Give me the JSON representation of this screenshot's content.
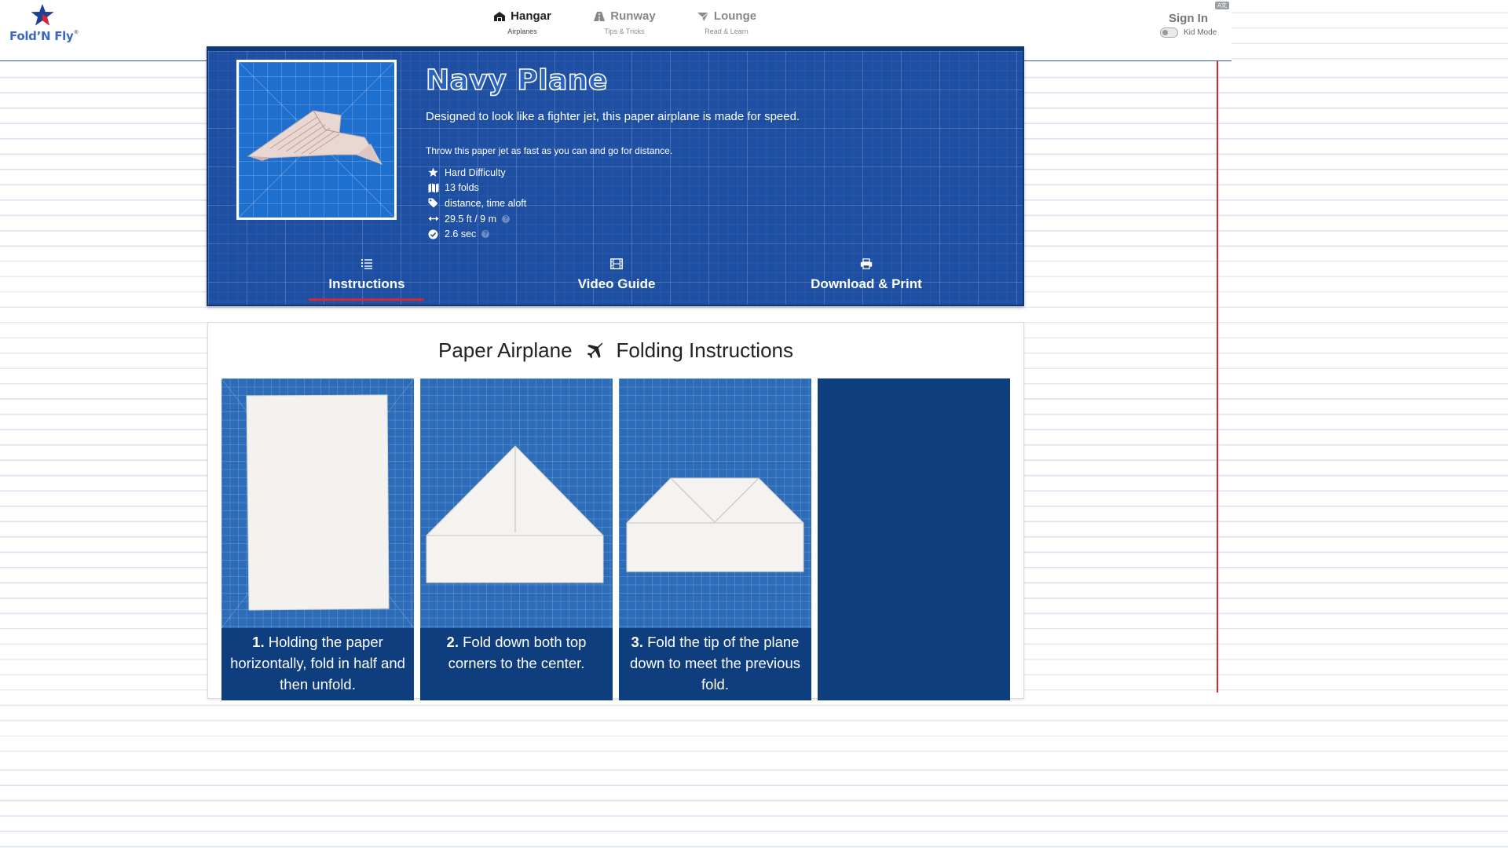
{
  "logo": {
    "brand": "Fold’N Fly",
    "registered": "®"
  },
  "nav": [
    {
      "label": "Hangar",
      "sub": "Airplanes",
      "icon": "hangar-icon",
      "active": true
    },
    {
      "label": "Runway",
      "sub": "Tips & Tricks",
      "icon": "runway-icon",
      "active": false
    },
    {
      "label": "Lounge",
      "sub": "Read & Learn",
      "icon": "lounge-icon",
      "active": false
    }
  ],
  "account": {
    "sign_in": "Sign In",
    "kid_mode": "Kid Mode",
    "kid_mode_on": false,
    "language_badge": "A文"
  },
  "plane": {
    "name": "Navy Plane",
    "description": "Designed to look like a fighter jet, this paper airplane is made for speed.",
    "tip": "Throw this paper jet as fast as you can and go for distance.",
    "facts": [
      {
        "icon": "star-icon",
        "text": "Hard Difficulty",
        "help": false
      },
      {
        "icon": "map-icon",
        "text": "13 folds",
        "help": false
      },
      {
        "icon": "tag-icon",
        "text": "distance, time aloft",
        "help": false
      },
      {
        "icon": "distance-arrows-icon",
        "text": "29.5 ft / 9 m",
        "help": true
      },
      {
        "icon": "check-circle-icon",
        "text": "2.6 sec",
        "help": true
      }
    ]
  },
  "tabs": [
    {
      "label": "Instructions",
      "icon": "list-icon",
      "active": true
    },
    {
      "label": "Video Guide",
      "icon": "film-icon",
      "active": false
    },
    {
      "label": "Download & Print",
      "icon": "print-icon",
      "active": false
    }
  ],
  "instructions": {
    "title_left": "Paper Airplane",
    "title_right": "Folding Instructions",
    "title_icon": "airplane-icon",
    "steps": [
      {
        "number": "1.",
        "text": "Holding the paper horizontally, fold in half and then unfold."
      },
      {
        "number": "2.",
        "text": "Fold down both top corners to the center."
      },
      {
        "number": "3.",
        "text": "Fold the tip of the plane down to meet the previous fold."
      },
      {
        "number": "",
        "text": ""
      }
    ]
  },
  "colors": {
    "brand_blue": "#1e4fa3",
    "navy": "#0f3e7f",
    "accent_red": "#d8262c",
    "notebook_line": "#dfe3f2"
  }
}
